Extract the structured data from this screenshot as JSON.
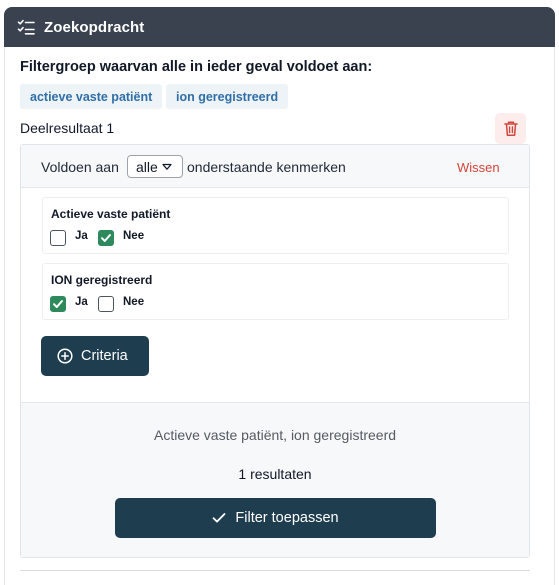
{
  "header": {
    "title": "Zoekopdracht",
    "icon": "checklist-icon"
  },
  "filter_group": {
    "title": "Filtergroep waarvan alle in ieder geval voldoet aan:",
    "tags": [
      "actieve vaste patiënt",
      "ion geregistreerd"
    ]
  },
  "sub_result": {
    "label": "Deelresultaat 1",
    "delete_icon": "trash-icon",
    "match": {
      "prefix": "Voldoen aan",
      "mode": "alle",
      "suffix": "onderstaande kenmerken",
      "clear_label": "Wissen"
    },
    "criteria": [
      {
        "title": "Actieve vaste patiënt",
        "options": [
          {
            "label": "Ja",
            "checked": false
          },
          {
            "label": "Nee",
            "checked": true
          }
        ]
      },
      {
        "title": "ION geregistreerd",
        "options": [
          {
            "label": "Ja",
            "checked": true
          },
          {
            "label": "Nee",
            "checked": false
          }
        ]
      }
    ],
    "add_criteria_label": "Criteria",
    "summary": "Actieve vaste patiënt, ion geregistreerd",
    "result_count": "1 resultaten",
    "apply_label": "Filter toepassen"
  },
  "colors": {
    "header_bg": "#3a4250",
    "primary": "#1e3d4f",
    "checked": "#2e8a5c",
    "danger": "#d2453a",
    "tag_text": "#2f6fa7"
  }
}
